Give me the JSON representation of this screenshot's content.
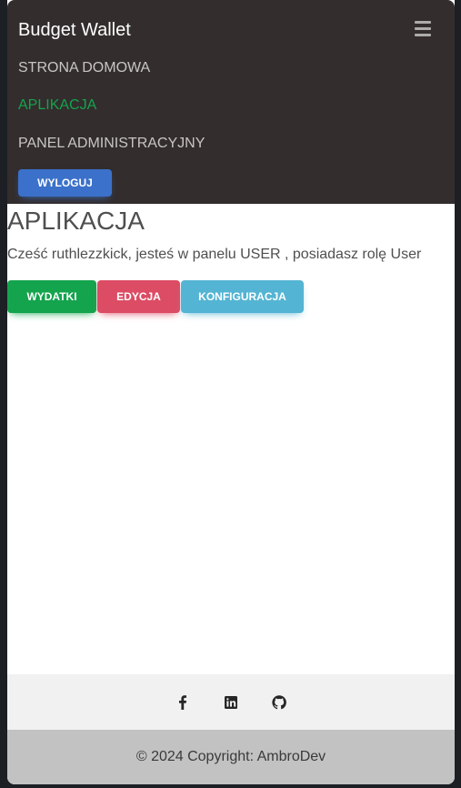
{
  "navbar": {
    "brand": "Budget Wallet",
    "links": [
      {
        "label": "STRONA DOMOWA",
        "active": false
      },
      {
        "label": "APLIKACJA",
        "active": true
      },
      {
        "label": "PANEL ADMINISTRACYJNY",
        "active": false
      }
    ],
    "logout_label": "WYLOGUJ",
    "menu_icon": "hamburger-icon"
  },
  "main": {
    "title": "APLIKACJA",
    "greeting": "Cześć ruthlezzkick, jesteś w panelu USER , posiadasz rolę User",
    "buttons": [
      {
        "label": "WYDATKI",
        "color": "#14a44d"
      },
      {
        "label": "EDYCJA",
        "color": "#dc4c64"
      },
      {
        "label": "KONFIGURACJA",
        "color": "#54b4d3"
      }
    ]
  },
  "footer": {
    "social_icons": [
      "facebook-icon",
      "linkedin-icon",
      "github-icon"
    ],
    "copyright": "© 2024 Copyright: AmbroDev"
  },
  "colors": {
    "navbar_bg": "#332d2d",
    "active_link": "#14a44d",
    "primary": "#3b71ca"
  }
}
